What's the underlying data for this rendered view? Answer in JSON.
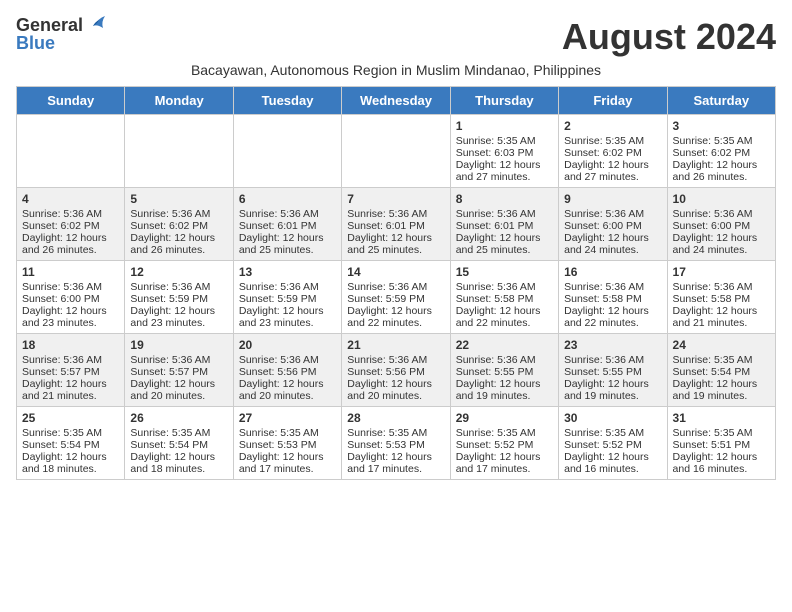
{
  "header": {
    "logo_general": "General",
    "logo_blue": "Blue",
    "month_title": "August 2024",
    "subtitle": "Bacayawan, Autonomous Region in Muslim Mindanao, Philippines"
  },
  "weekdays": [
    "Sunday",
    "Monday",
    "Tuesday",
    "Wednesday",
    "Thursday",
    "Friday",
    "Saturday"
  ],
  "weeks": [
    [
      {
        "day": "",
        "sunrise": "",
        "sunset": "",
        "daylight": ""
      },
      {
        "day": "",
        "sunrise": "",
        "sunset": "",
        "daylight": ""
      },
      {
        "day": "",
        "sunrise": "",
        "sunset": "",
        "daylight": ""
      },
      {
        "day": "",
        "sunrise": "",
        "sunset": "",
        "daylight": ""
      },
      {
        "day": "1",
        "sunrise": "Sunrise: 5:35 AM",
        "sunset": "Sunset: 6:03 PM",
        "daylight": "Daylight: 12 hours and 27 minutes."
      },
      {
        "day": "2",
        "sunrise": "Sunrise: 5:35 AM",
        "sunset": "Sunset: 6:02 PM",
        "daylight": "Daylight: 12 hours and 27 minutes."
      },
      {
        "day": "3",
        "sunrise": "Sunrise: 5:35 AM",
        "sunset": "Sunset: 6:02 PM",
        "daylight": "Daylight: 12 hours and 26 minutes."
      }
    ],
    [
      {
        "day": "4",
        "sunrise": "Sunrise: 5:36 AM",
        "sunset": "Sunset: 6:02 PM",
        "daylight": "Daylight: 12 hours and 26 minutes."
      },
      {
        "day": "5",
        "sunrise": "Sunrise: 5:36 AM",
        "sunset": "Sunset: 6:02 PM",
        "daylight": "Daylight: 12 hours and 26 minutes."
      },
      {
        "day": "6",
        "sunrise": "Sunrise: 5:36 AM",
        "sunset": "Sunset: 6:01 PM",
        "daylight": "Daylight: 12 hours and 25 minutes."
      },
      {
        "day": "7",
        "sunrise": "Sunrise: 5:36 AM",
        "sunset": "Sunset: 6:01 PM",
        "daylight": "Daylight: 12 hours and 25 minutes."
      },
      {
        "day": "8",
        "sunrise": "Sunrise: 5:36 AM",
        "sunset": "Sunset: 6:01 PM",
        "daylight": "Daylight: 12 hours and 25 minutes."
      },
      {
        "day": "9",
        "sunrise": "Sunrise: 5:36 AM",
        "sunset": "Sunset: 6:00 PM",
        "daylight": "Daylight: 12 hours and 24 minutes."
      },
      {
        "day": "10",
        "sunrise": "Sunrise: 5:36 AM",
        "sunset": "Sunset: 6:00 PM",
        "daylight": "Daylight: 12 hours and 24 minutes."
      }
    ],
    [
      {
        "day": "11",
        "sunrise": "Sunrise: 5:36 AM",
        "sunset": "Sunset: 6:00 PM",
        "daylight": "Daylight: 12 hours and 23 minutes."
      },
      {
        "day": "12",
        "sunrise": "Sunrise: 5:36 AM",
        "sunset": "Sunset: 5:59 PM",
        "daylight": "Daylight: 12 hours and 23 minutes."
      },
      {
        "day": "13",
        "sunrise": "Sunrise: 5:36 AM",
        "sunset": "Sunset: 5:59 PM",
        "daylight": "Daylight: 12 hours and 23 minutes."
      },
      {
        "day": "14",
        "sunrise": "Sunrise: 5:36 AM",
        "sunset": "Sunset: 5:59 PM",
        "daylight": "Daylight: 12 hours and 22 minutes."
      },
      {
        "day": "15",
        "sunrise": "Sunrise: 5:36 AM",
        "sunset": "Sunset: 5:58 PM",
        "daylight": "Daylight: 12 hours and 22 minutes."
      },
      {
        "day": "16",
        "sunrise": "Sunrise: 5:36 AM",
        "sunset": "Sunset: 5:58 PM",
        "daylight": "Daylight: 12 hours and 22 minutes."
      },
      {
        "day": "17",
        "sunrise": "Sunrise: 5:36 AM",
        "sunset": "Sunset: 5:58 PM",
        "daylight": "Daylight: 12 hours and 21 minutes."
      }
    ],
    [
      {
        "day": "18",
        "sunrise": "Sunrise: 5:36 AM",
        "sunset": "Sunset: 5:57 PM",
        "daylight": "Daylight: 12 hours and 21 minutes."
      },
      {
        "day": "19",
        "sunrise": "Sunrise: 5:36 AM",
        "sunset": "Sunset: 5:57 PM",
        "daylight": "Daylight: 12 hours and 20 minutes."
      },
      {
        "day": "20",
        "sunrise": "Sunrise: 5:36 AM",
        "sunset": "Sunset: 5:56 PM",
        "daylight": "Daylight: 12 hours and 20 minutes."
      },
      {
        "day": "21",
        "sunrise": "Sunrise: 5:36 AM",
        "sunset": "Sunset: 5:56 PM",
        "daylight": "Daylight: 12 hours and 20 minutes."
      },
      {
        "day": "22",
        "sunrise": "Sunrise: 5:36 AM",
        "sunset": "Sunset: 5:55 PM",
        "daylight": "Daylight: 12 hours and 19 minutes."
      },
      {
        "day": "23",
        "sunrise": "Sunrise: 5:36 AM",
        "sunset": "Sunset: 5:55 PM",
        "daylight": "Daylight: 12 hours and 19 minutes."
      },
      {
        "day": "24",
        "sunrise": "Sunrise: 5:35 AM",
        "sunset": "Sunset: 5:54 PM",
        "daylight": "Daylight: 12 hours and 19 minutes."
      }
    ],
    [
      {
        "day": "25",
        "sunrise": "Sunrise: 5:35 AM",
        "sunset": "Sunset: 5:54 PM",
        "daylight": "Daylight: 12 hours and 18 minutes."
      },
      {
        "day": "26",
        "sunrise": "Sunrise: 5:35 AM",
        "sunset": "Sunset: 5:54 PM",
        "daylight": "Daylight: 12 hours and 18 minutes."
      },
      {
        "day": "27",
        "sunrise": "Sunrise: 5:35 AM",
        "sunset": "Sunset: 5:53 PM",
        "daylight": "Daylight: 12 hours and 17 minutes."
      },
      {
        "day": "28",
        "sunrise": "Sunrise: 5:35 AM",
        "sunset": "Sunset: 5:53 PM",
        "daylight": "Daylight: 12 hours and 17 minutes."
      },
      {
        "day": "29",
        "sunrise": "Sunrise: 5:35 AM",
        "sunset": "Sunset: 5:52 PM",
        "daylight": "Daylight: 12 hours and 17 minutes."
      },
      {
        "day": "30",
        "sunrise": "Sunrise: 5:35 AM",
        "sunset": "Sunset: 5:52 PM",
        "daylight": "Daylight: 12 hours and 16 minutes."
      },
      {
        "day": "31",
        "sunrise": "Sunrise: 5:35 AM",
        "sunset": "Sunset: 5:51 PM",
        "daylight": "Daylight: 12 hours and 16 minutes."
      }
    ]
  ]
}
